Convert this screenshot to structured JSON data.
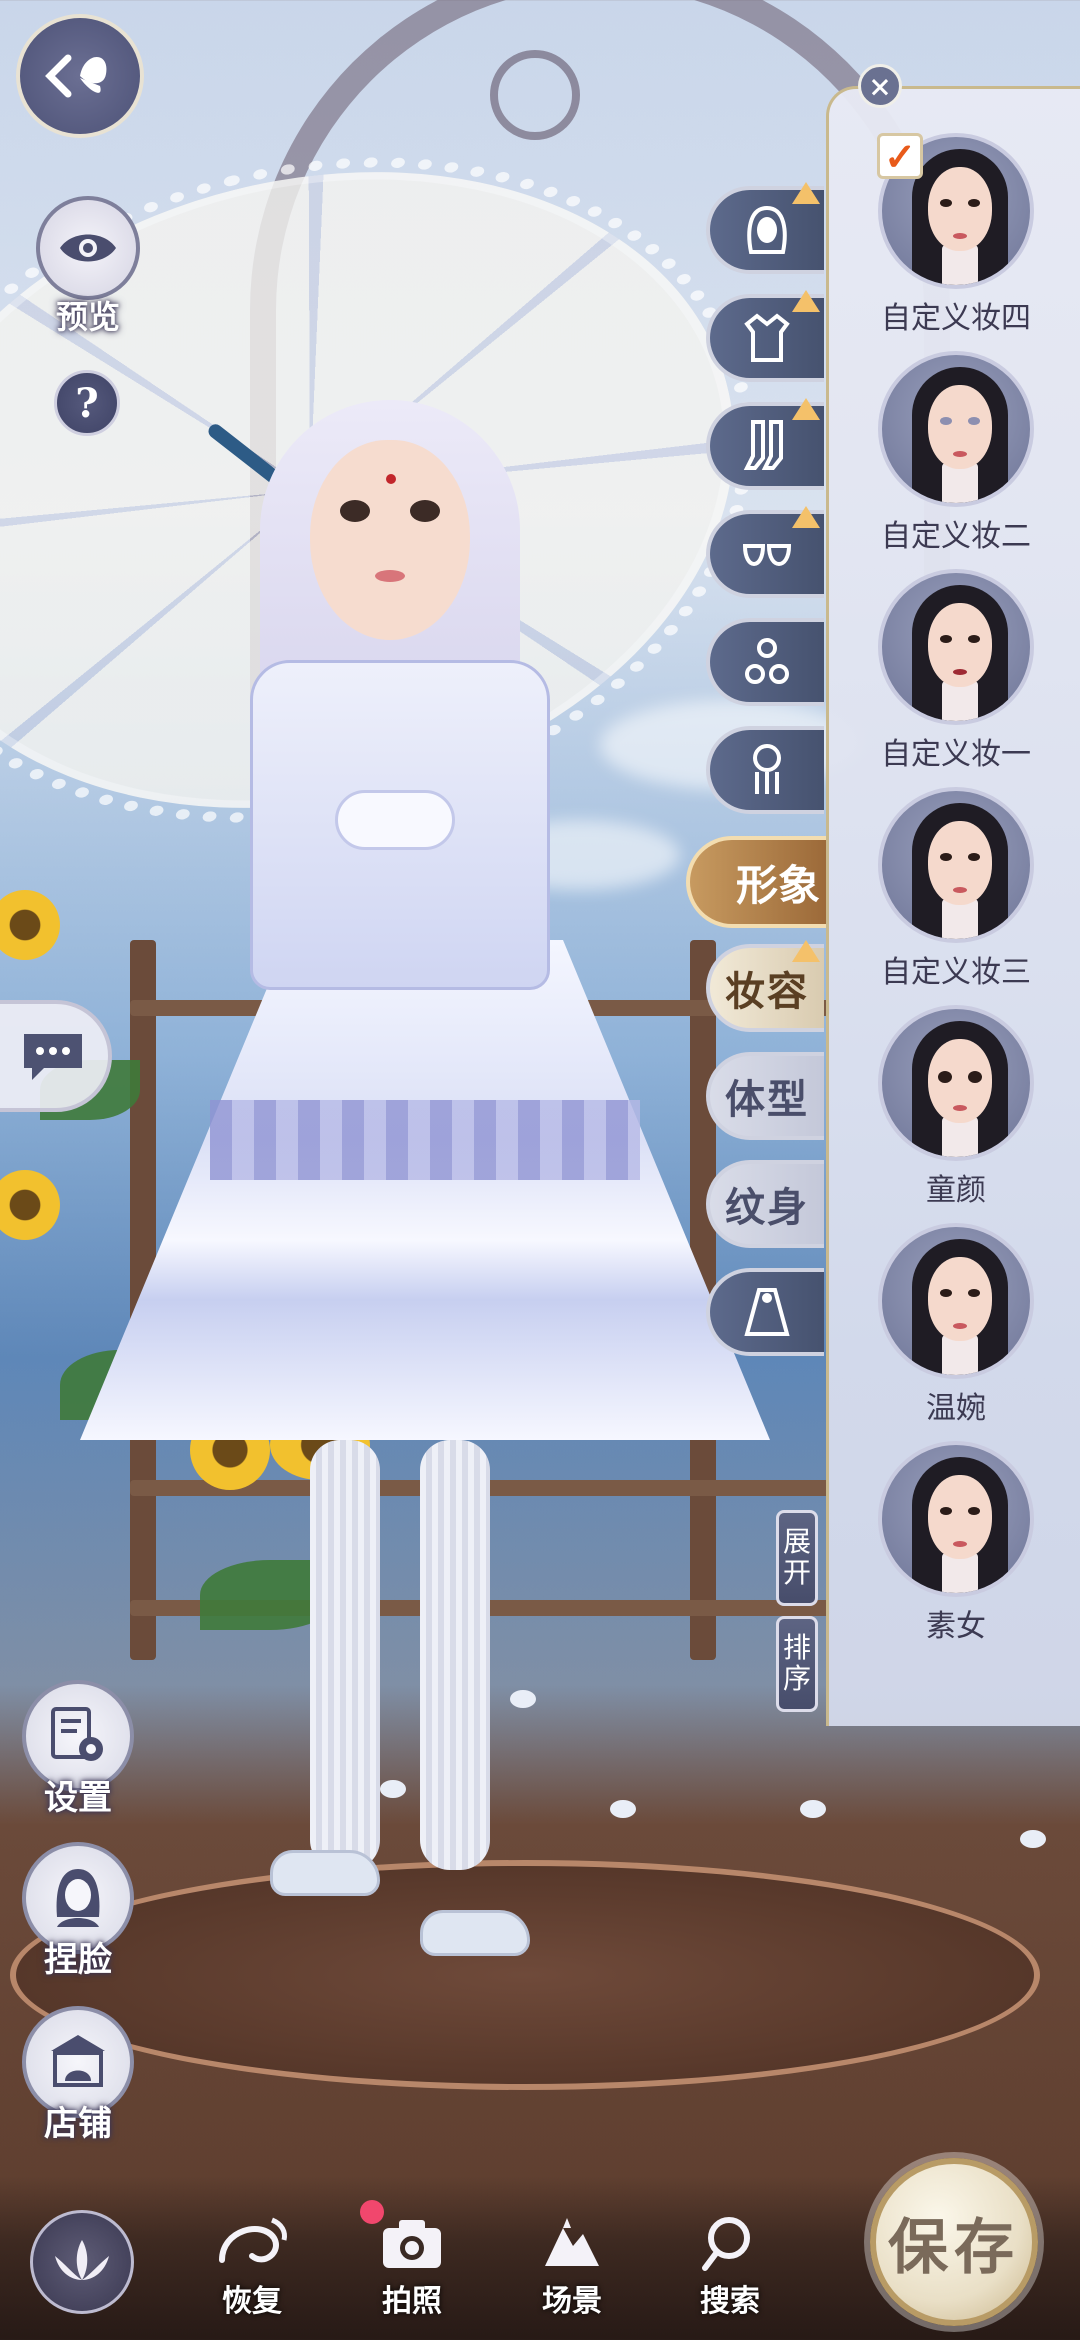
{
  "top_left": {
    "back_icon": "back-butterfly-icon",
    "preview_label": "预览",
    "help_glyph": "?"
  },
  "categories": {
    "icon_tabs": [
      "hair-icon",
      "outfit-icon",
      "stockings-icon",
      "shoes-icon",
      "accessory-icon",
      "hairpin-icon"
    ],
    "xingxiang": "形象",
    "makeup": "妆容",
    "body": "体型",
    "tattoo": "纹身",
    "last_icon": "cape-icon"
  },
  "panel": {
    "close_glyph": "×",
    "check_glyph": "✓",
    "items": [
      {
        "label": "自定义妆四",
        "selected": true
      },
      {
        "label": "自定义妆二",
        "selected": false
      },
      {
        "label": "自定义妆一",
        "selected": false
      },
      {
        "label": "自定义妆三",
        "selected": false
      },
      {
        "label": "童颜",
        "selected": false
      },
      {
        "label": "温婉",
        "selected": false
      },
      {
        "label": "素女",
        "selected": false
      }
    ],
    "expand_chars": [
      "展",
      "开"
    ],
    "sort_chars": [
      "排",
      "序"
    ]
  },
  "side_tools": [
    {
      "label": "设置",
      "icon": "settings-icon"
    },
    {
      "label": "捏脸",
      "icon": "face-edit-icon"
    },
    {
      "label": "店铺",
      "icon": "shop-icon"
    }
  ],
  "bottom_bar": {
    "lotus_icon": "lotus-icon",
    "restore": "恢复",
    "photo": "拍照",
    "scene": "场景",
    "search": "搜索",
    "save": "保存"
  },
  "colors": {
    "accent_gold": "#b89b65",
    "panel_bg": "#e3e6f2",
    "tab_dark": "#4a5572",
    "photo_badge": "#f1476d",
    "check_orange": "#e85a1a"
  }
}
